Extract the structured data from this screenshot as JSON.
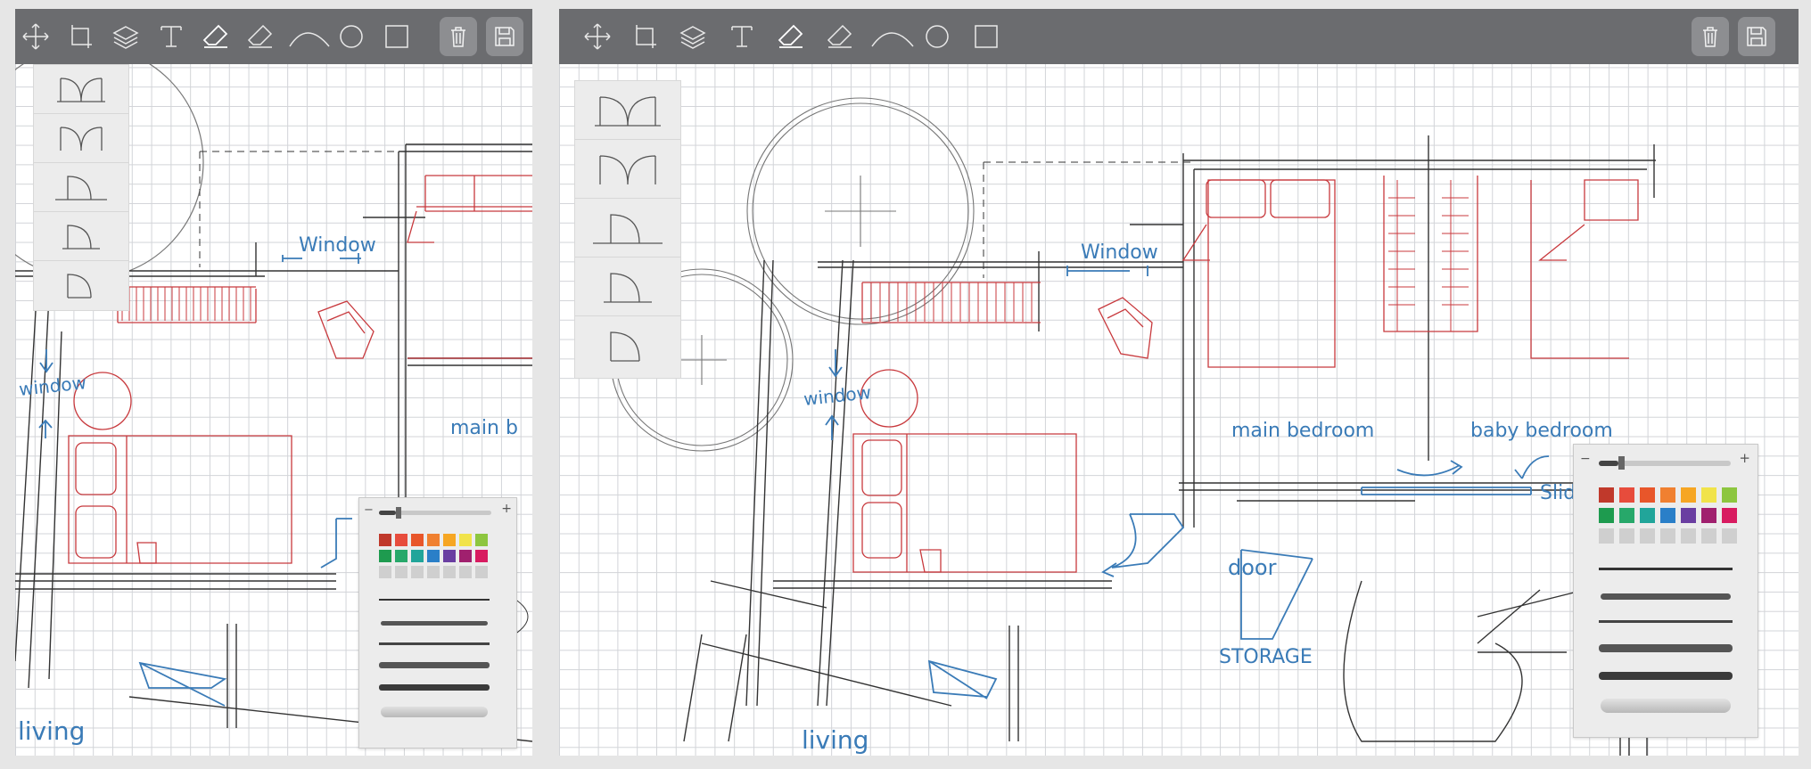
{
  "toolbar": {
    "tools": [
      "move-icon",
      "crop-icon",
      "layers-icon",
      "text-icon",
      "eraser-icon",
      "ruler-eraser-icon",
      "arc-icon",
      "circle-icon",
      "rectangle-icon"
    ],
    "actions": [
      "trash-icon",
      "save-icon"
    ]
  },
  "labels": {
    "window": "Window",
    "window_vertical": "window",
    "main_bedroom": "main bedroom",
    "main_bedroom_cut": "main b",
    "baby_bedroom": "baby bedroom",
    "door": "door",
    "storage": "STORAGE",
    "living": "living",
    "sliding_cut": "Slid"
  },
  "palette": {
    "minus": "−",
    "plus": "+",
    "slider_level": 0.15,
    "colors": [
      [
        "#c0392b",
        "#e74c3c",
        "#e8562a",
        "#f08030",
        "#f6a623",
        "#f1e34a",
        "#8dc63f"
      ],
      [
        "#1e9b4f",
        "#27a86a",
        "#21a59a",
        "#2a7fc8",
        "#6a3ea1",
        "#a0206e",
        "#d81b60"
      ],
      [
        "#cfcfcf",
        "#cfcfcf",
        "#cfcfcf",
        "#cfcfcf",
        "#cfcfcf",
        "#cfcfcf",
        "#cfcfcf"
      ]
    ]
  },
  "shape_templates": [
    "double-door-icon",
    "double-door-icon",
    "door-swing-icon",
    "door-swing-icon",
    "door-swing-icon"
  ]
}
